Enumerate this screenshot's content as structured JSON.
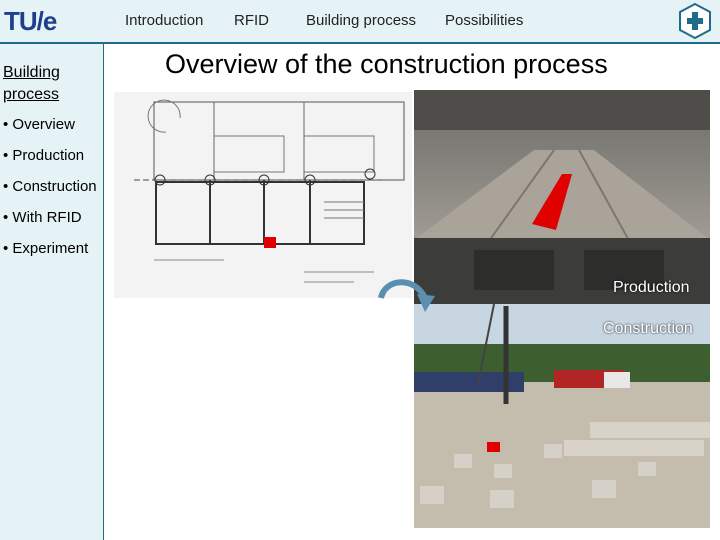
{
  "header": {
    "logo_text": "TU/e",
    "brand_icon": "tue-emblem-icon",
    "nav": [
      "Introduction",
      "RFID",
      "Building process",
      "Possibilities"
    ]
  },
  "sidebar": {
    "title": "Building process",
    "items": [
      "• Overview",
      "• Production",
      "• Construction",
      "• With RFID",
      "• Experiment"
    ]
  },
  "main": {
    "title": "Overview of the construction process",
    "labels": {
      "production": "Production",
      "construction": "Construction"
    },
    "images": [
      "floor-plan-drawing",
      "factory-production-photo",
      "construction-site-photo"
    ]
  },
  "colors": {
    "accent": "#1f6b8c",
    "panel": "#e6f3f6",
    "marker": "#e00000"
  }
}
